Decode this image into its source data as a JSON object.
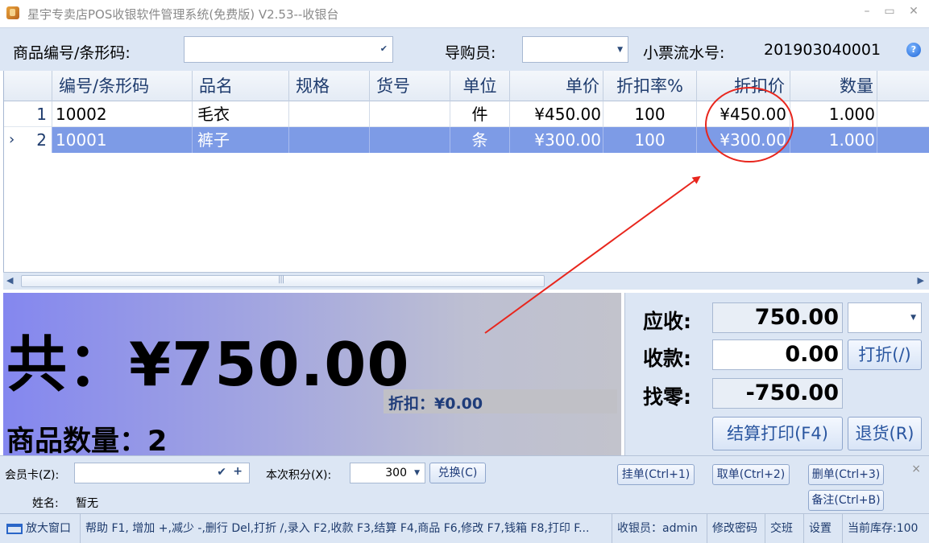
{
  "window": {
    "title": "星宇专卖店POS收银软件管理系统(免费版) V2.53--收银台",
    "minimize": "–",
    "maximize": "▭",
    "close": "✕"
  },
  "header": {
    "barcode_label": "商品编号/条形码:",
    "barcode_value": "",
    "guide_label": "导购员:",
    "guide_value": "",
    "ticket_label": "小票流水号:",
    "ticket_no": "201903040001"
  },
  "grid": {
    "columns": [
      "编号/条形码",
      "品名",
      "规格",
      "货号",
      "单位",
      "单价",
      "折扣率%",
      "折扣价",
      "数量"
    ],
    "rows": [
      {
        "idx": "1",
        "marker": "",
        "code": "10002",
        "name": "毛衣",
        "spec": "",
        "item_no": "",
        "unit": "件",
        "price": "¥450.00",
        "rate": "100",
        "disc_price": "¥450.00",
        "qty": "1.000"
      },
      {
        "idx": "2",
        "marker": "›",
        "code": "10001",
        "name": "裤子",
        "spec": "",
        "item_no": "",
        "unit": "条",
        "price": "¥300.00",
        "rate": "100",
        "disc_price": "¥300.00",
        "qty": "1.000"
      }
    ]
  },
  "summary": {
    "total_text": "共：¥750.00",
    "discount_text": "折扣：¥0.00",
    "count_text": "商品数量：2"
  },
  "payment": {
    "receivable_label": "应收:",
    "receivable": "750.00",
    "received_label": "收款:",
    "received": "0.00",
    "change_label": "找零:",
    "change": "-750.00",
    "discount_btn": "打折(/)",
    "settle_btn": "结算打印(F4)",
    "return_btn": "退货(R)"
  },
  "member": {
    "card_label": "会员卡(Z):",
    "card_value": "",
    "points_label": "本次积分(X):",
    "points_value": "300",
    "redeem_btn": "兑换(C)",
    "name_label": "姓名:",
    "name_value": "暂无",
    "hold_btn": "挂单(Ctrl+1)",
    "retrieve_btn": "取单(Ctrl+2)",
    "delete_btn": "删单(Ctrl+3)",
    "note_btn": "备注(Ctrl+B)",
    "close": "×"
  },
  "status": {
    "enlarge": "放大窗口",
    "help": "帮助 F1, 增加 +,减少 -,删行 Del,打折 /,录入 F2,收款 F3,结算 F4,商品 F6,修改 F7,钱箱 F8,打印 F...",
    "cashier": "收银员：admin",
    "change_pwd": "修改密码",
    "shift": "交班",
    "settings": "设置",
    "stock": "当前库存:100"
  },
  "colors": {
    "selected_row": "#7d9be6",
    "annotation": "#e8261d",
    "panel_bg": "#dce6f4"
  }
}
